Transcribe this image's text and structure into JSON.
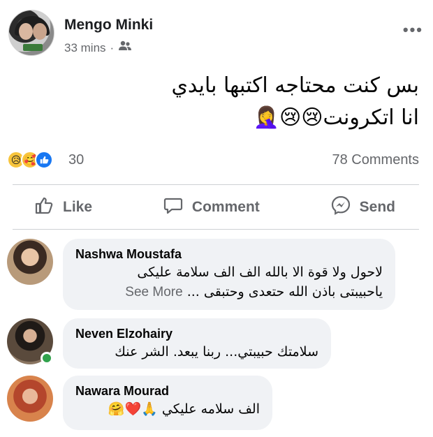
{
  "post": {
    "author": "Mengo Minki",
    "time": "33 mins",
    "separator": "·",
    "privacy_icon": "friends-icon",
    "more_label": "•••",
    "text_line1": "بس كنت محتاجه اكتبها بايدي",
    "text_line2": "انا اتكرونت😢😢🤦‍♀️"
  },
  "reactions": {
    "icons": [
      "sad",
      "care",
      "like"
    ],
    "count": "30",
    "comments": "78 Comments"
  },
  "actions": {
    "like": "Like",
    "comment": "Comment",
    "send": "Send"
  },
  "comments": [
    {
      "name": "Nashwa Moustafa",
      "line1": "لاحول ولا قوة الا بالله الف الف سلامة عليكى",
      "line2": "ياحبيبتى باذن الله حتعدى وحتبقى ...",
      "see_more": "See More"
    },
    {
      "name": "Neven Elzohairy",
      "line1": "سلامتك حبيبتي... ربنا يبعد. الشر عنك",
      "online": true
    },
    {
      "name": "Nawara Mourad",
      "line1": "الف سلامه عليكي 🙏❤️🤗"
    }
  ],
  "colors": {
    "accent": "#1877f2",
    "muted": "#65676b",
    "bubble": "#f0f2f5",
    "online": "#31a24c"
  }
}
